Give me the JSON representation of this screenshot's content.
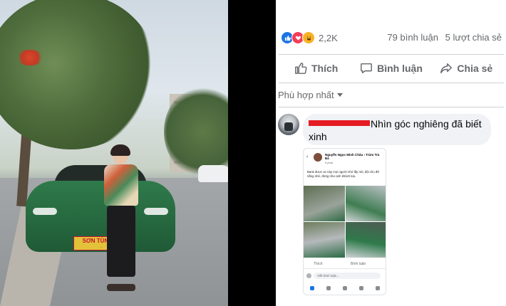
{
  "post": {
    "reaction_count": "2,2K",
    "comments": "79 bình luận",
    "shares": "5 lượt chia sẻ",
    "reaction_icons": [
      "like-icon",
      "love-icon",
      "haha-icon"
    ]
  },
  "actions": {
    "like": "Thích",
    "comment": "Bình luận",
    "share": "Chia sẻ"
  },
  "sort": {
    "label": "Phù hợp nhất"
  },
  "comment": {
    "text_line1": "Nhìn góc nghiêng đã biết",
    "text_line2": "xinh"
  },
  "photo": {
    "plate_text": "SƠN TÙNG AI"
  },
  "attachment": {
    "page_name": "Nguyễn Ngọc Minh Châu › Trùm Trà Đá",
    "time": "9 phút",
    "description": "Bank được xe này mọi người nhớ lấy mũ, đội cho đỡ nắng nhé, đừng như anh khách kia.",
    "like": "Thích",
    "comment": "Bình luận",
    "input_placeholder": "Viết bình luận..."
  },
  "colors": {
    "accent": "#1b74e4",
    "love": "#f33e58",
    "haha": "#f7b125",
    "redaction": "#e51c23"
  }
}
